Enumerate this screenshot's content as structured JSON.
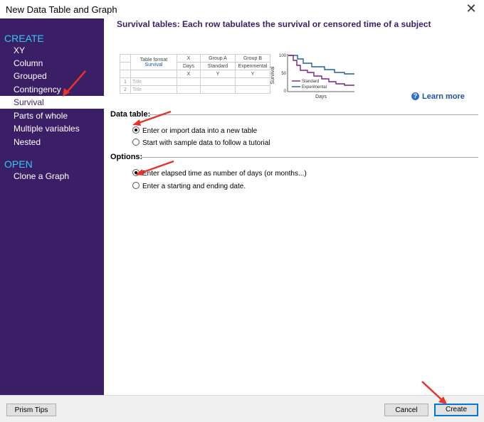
{
  "window": {
    "title": "New Data Table and Graph",
    "close_glyph": "✕"
  },
  "sidebar": {
    "create_header": "CREATE",
    "create_items": [
      "XY",
      "Column",
      "Grouped",
      "Contingency",
      "Survival",
      "Parts of whole",
      "Multiple variables",
      "Nested"
    ],
    "selected_index": 4,
    "open_header": "OPEN",
    "open_items": [
      "Clone a Graph"
    ]
  },
  "main": {
    "heading": "Survival tables: Each row tabulates the survival or censored time of a subject",
    "preview_table": {
      "format_label": "Table format",
      "format_value": "Survival",
      "col_headers": [
        "X",
        "Group A",
        "Group B"
      ],
      "sub_headers": [
        "Days",
        "Standard",
        "Experimental"
      ],
      "col_types": [
        "X",
        "Y",
        "Y"
      ],
      "row_numbers": [
        "1",
        "2"
      ],
      "row_placeholder": "Title"
    },
    "preview_chart": {
      "y_label": "Survival",
      "x_label": "Days",
      "y_ticks": [
        "100",
        "50",
        "0"
      ],
      "series": [
        {
          "name": "Standard",
          "color": "#7b1e8f"
        },
        {
          "name": "Experimental",
          "color": "#1f5fa8"
        }
      ]
    },
    "learn_more": "Learn more",
    "learn_icon": "?",
    "data_table_label": "Data table:",
    "data_table_options": [
      "Enter or import data into a new table",
      "Start with sample data to follow a tutorial"
    ],
    "data_table_selected": 0,
    "options_label": "Options:",
    "options_options": [
      "Enter elapsed time as number of days (or months...)",
      "Enter a starting and ending date."
    ],
    "options_selected": 0
  },
  "footer": {
    "tips": "Prism Tips",
    "cancel": "Cancel",
    "create": "Create"
  },
  "colors": {
    "sidebar_bg": "#3a1f66",
    "section_header": "#33c9ef",
    "accent_blue": "#1f4fa8",
    "arrow_red": "#e8332a"
  }
}
